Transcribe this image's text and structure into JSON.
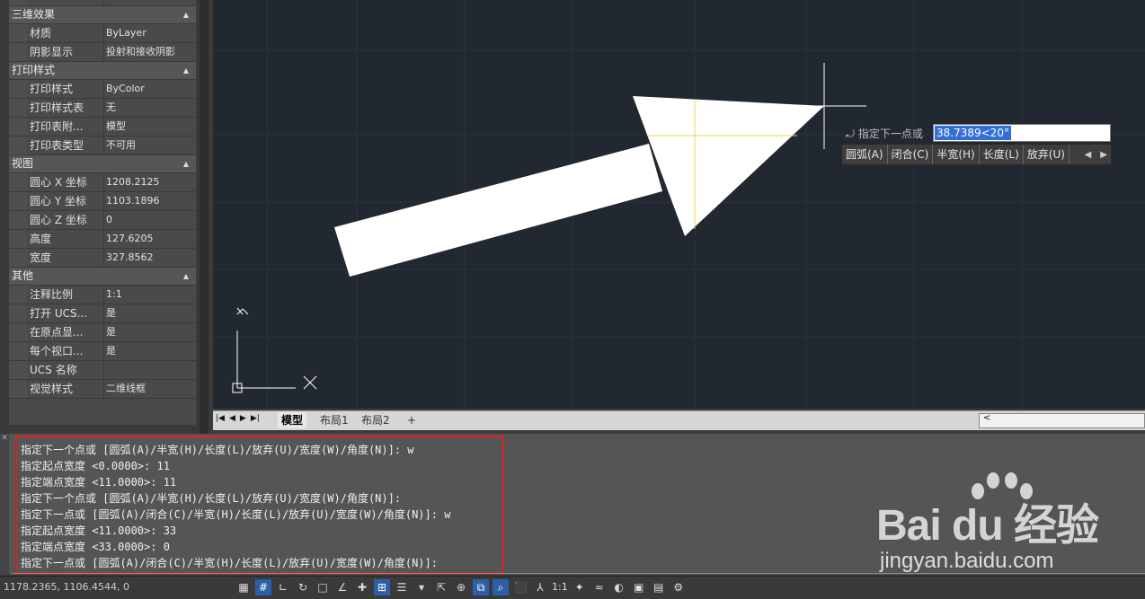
{
  "properties": {
    "sections": [
      {
        "title": "三维效果",
        "rows": [
          {
            "key": "材质",
            "value": "ByLayer"
          },
          {
            "key": "阴影显示",
            "value": "投射和接收阴影"
          }
        ]
      },
      {
        "title": "打印样式",
        "rows": [
          {
            "key": "打印样式",
            "value": "ByColor"
          },
          {
            "key": "打印样式表",
            "value": "无"
          },
          {
            "key": "打印表附...",
            "value": "模型"
          },
          {
            "key": "打印表类型",
            "value": "不可用"
          }
        ]
      },
      {
        "title": "视图",
        "rows": [
          {
            "key": "圆心 X 坐标",
            "value": "1208.2125"
          },
          {
            "key": "圆心 Y 坐标",
            "value": "1103.1896"
          },
          {
            "key": "圆心 Z 坐标",
            "value": "0"
          },
          {
            "key": "高度",
            "value": "127.6205"
          },
          {
            "key": "宽度",
            "value": "327.8562"
          }
        ]
      },
      {
        "title": "其他",
        "rows": [
          {
            "key": "注释比例",
            "value": "1:1"
          },
          {
            "key": "打开 UCS...",
            "value": "是"
          },
          {
            "key": "在原点显...",
            "value": "是"
          },
          {
            "key": "每个视口...",
            "value": "是"
          },
          {
            "key": "UCS 名称",
            "value": ""
          },
          {
            "key": "视觉样式",
            "value": "二维线框"
          }
        ]
      }
    ]
  },
  "viewport": {
    "ucs_y_label": "Y",
    "ucs_x_label": "X"
  },
  "dynamic_input": {
    "prompt": "指定下一点或",
    "value": "38.7389<20°",
    "options": [
      "圆弧(A)",
      "闭合(C)",
      "半宽(H)",
      "长度(L)",
      "放弃(U)"
    ]
  },
  "tabs": {
    "items": [
      "模型",
      "布局1",
      "布局2",
      "+"
    ],
    "active": "模型"
  },
  "command_history": [
    "指定下一个点或 [圆弧(A)/半宽(H)/长度(L)/放弃(U)/宽度(W)/角度(N)]: w",
    "指定起点宽度 <0.0000>: 11",
    "指定端点宽度 <11.0000>: 11",
    "指定下一个点或 [圆弧(A)/半宽(H)/长度(L)/放弃(U)/宽度(W)/角度(N)]:",
    "指定下一点或 [圆弧(A)/闭合(C)/半宽(H)/长度(L)/放弃(U)/宽度(W)/角度(N)]: w",
    "指定起点宽度 <11.0000>: 33",
    "指定端点宽度 <33.0000>: 0",
    "指定下一点或 [圆弧(A)/闭合(C)/半宽(H)/长度(L)/放弃(U)/宽度(W)/角度(N)]:"
  ],
  "status": {
    "coords": "1178.2365, 1106.4544, 0",
    "scale": "1:1",
    "icons": [
      "grid-icon",
      "snap-icon",
      "ortho-icon",
      "polar-icon",
      "osnap-icon",
      "otrack-icon",
      "ducs-icon",
      "dyn-icon",
      "lineweight-icon",
      "transparency-icon",
      "selection-cycling-icon",
      "annotation-monitor-icon",
      "layer-icon",
      "zoom-icon",
      "workspace-icon",
      "annotation-scale-icon",
      "annotation-visibility-icon",
      "auto-scale-icon",
      "isolate-icon",
      "hardware-accel-icon",
      "clean-screen-icon",
      "customize-icon"
    ]
  },
  "watermark": {
    "logo": "Bai du 经验",
    "url": "jingyan.baidu.com"
  }
}
